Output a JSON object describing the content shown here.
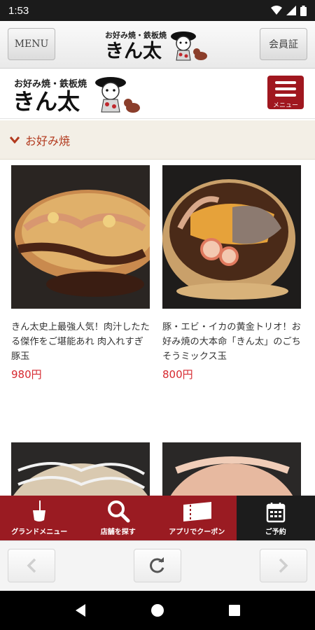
{
  "status_bar": {
    "time": "1:53"
  },
  "app_header": {
    "menu_label": "MENU",
    "member_label": "会員証",
    "logo_subtitle": "お好み焼・鉄板焼",
    "logo_title": "きん太"
  },
  "site_header": {
    "logo_subtitle": "お好み焼・鉄板焼",
    "logo_title": "きん太",
    "menu_button_label": "メニュー"
  },
  "section": {
    "title": "お好み焼"
  },
  "menu_items": [
    {
      "description": "きん太史上最強人気！肉汁したたる傑作をご堪能あれ 肉入れすぎ豚玉",
      "price": "980円"
    },
    {
      "description": "豚・エビ・イカの黄金トリオ！お好み焼の大本命「きん太」のごちそうミックス玉",
      "price": "800円"
    }
  ],
  "bottom_nav": [
    {
      "label": "グランドメニュー",
      "icon": "ladle-icon"
    },
    {
      "label": "店舗を探す",
      "icon": "search-icon"
    },
    {
      "label": "アプリでクーポン",
      "icon": "ticket-icon"
    },
    {
      "label": "ご予約",
      "icon": "calendar-icon"
    }
  ],
  "colors": {
    "brand_red": "#9a1b22",
    "accent_text": "#b23a1e",
    "price": "#d6282f"
  }
}
